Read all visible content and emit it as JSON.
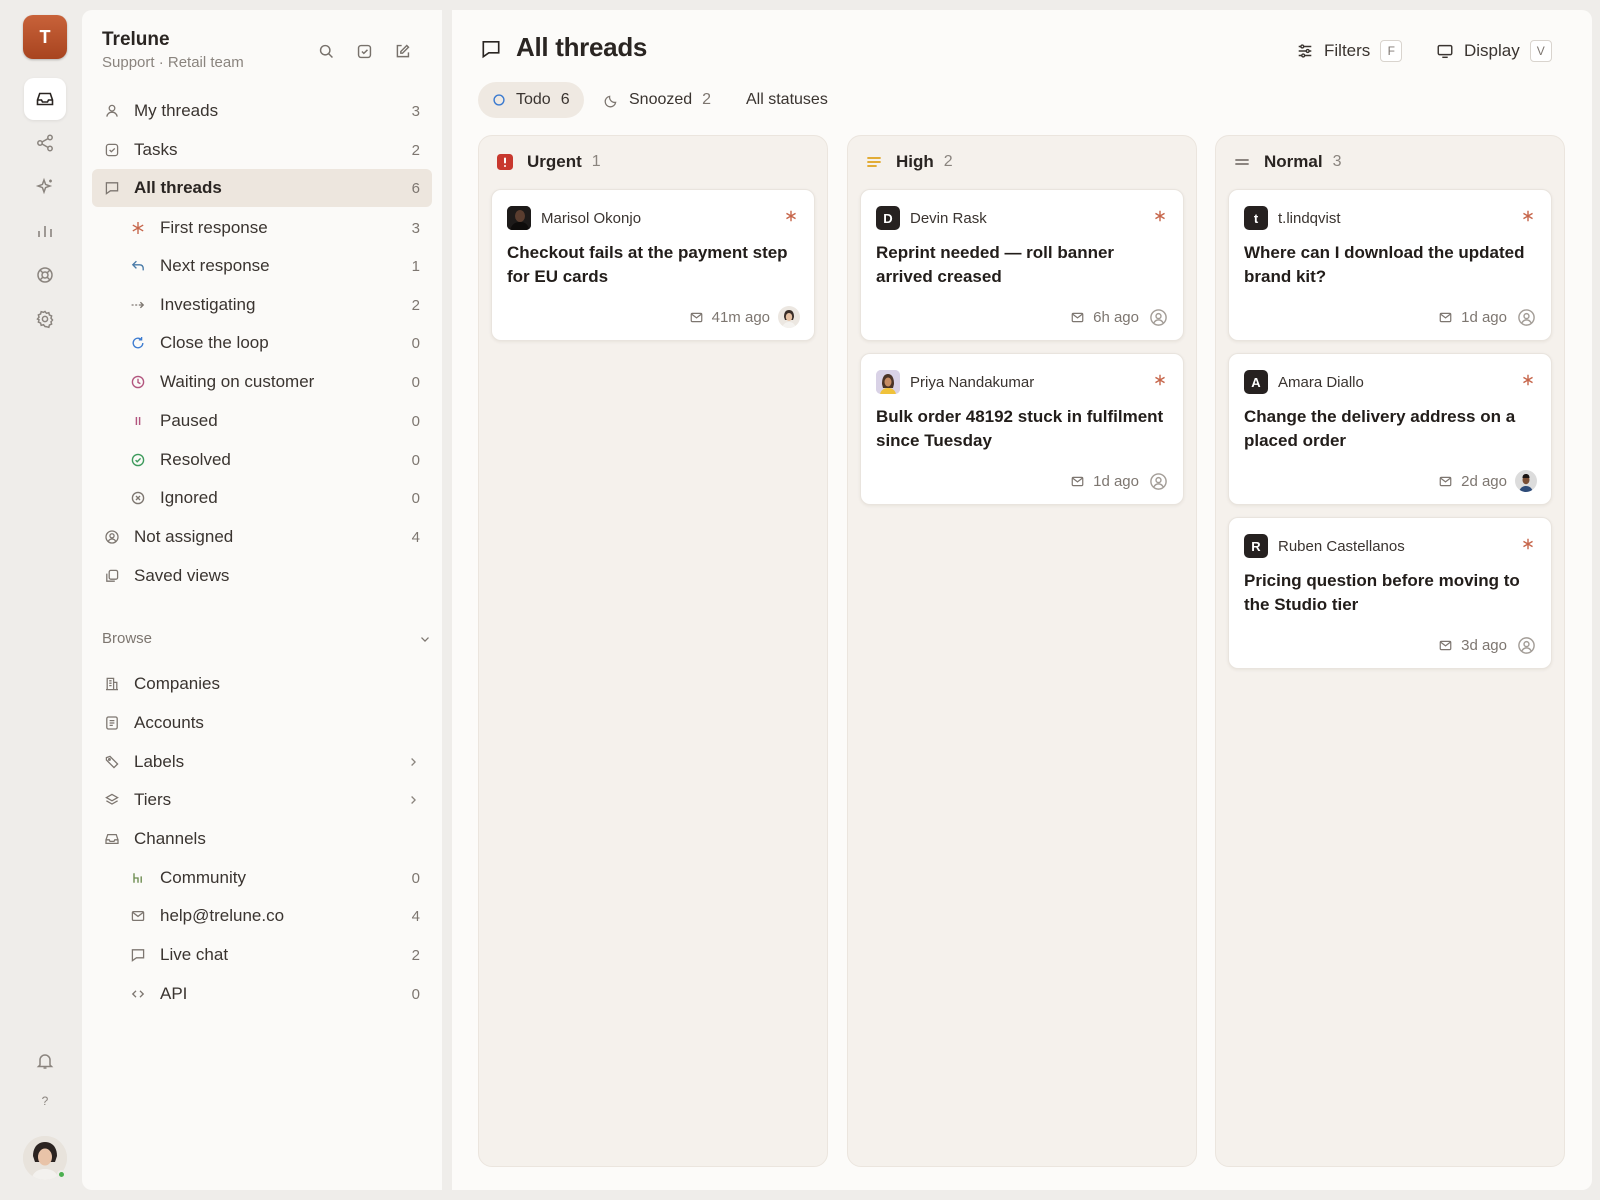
{
  "workspace": {
    "initial": "T",
    "name": "Trelune",
    "subtitle": "Support · Retail team"
  },
  "rail": {
    "items": [
      "inbox-icon",
      "share-icon",
      "sparkle-icon",
      "chart-icon",
      "lifebuoy-icon",
      "gear-icon"
    ],
    "help_label": "?"
  },
  "sidebar": {
    "nav": [
      {
        "label": "My threads",
        "count": "3",
        "icon": "user-icon"
      },
      {
        "label": "Tasks",
        "count": "2",
        "icon": "checkbox-icon"
      },
      {
        "label": "All threads",
        "count": "6",
        "icon": "chat-icon",
        "active": true
      }
    ],
    "subnav": [
      {
        "label": "First response",
        "count": "3",
        "icon": "asterisk-icon",
        "color": "#c6654a"
      },
      {
        "label": "Next response",
        "count": "1",
        "icon": "reply-icon",
        "color": "#4a7ba8"
      },
      {
        "label": "Investigating",
        "count": "2",
        "icon": "dashed-arrow-icon",
        "color": "#7d7670"
      },
      {
        "label": "Close the loop",
        "count": "0",
        "icon": "refresh-icon",
        "color": "#3c7bd0"
      },
      {
        "label": "Waiting on customer",
        "count": "0",
        "icon": "clock-icon",
        "color": "#b2557e"
      },
      {
        "label": "Paused",
        "count": "0",
        "icon": "pause-icon",
        "color": "#b2557e"
      },
      {
        "label": "Resolved",
        "count": "0",
        "icon": "check-circle-icon",
        "color": "#3d9a5c"
      },
      {
        "label": "Ignored",
        "count": "0",
        "icon": "x-circle-icon",
        "color": "#8a847e"
      }
    ],
    "nav2": [
      {
        "label": "Not assigned",
        "count": "4",
        "icon": "user-circle-icon"
      },
      {
        "label": "Saved views",
        "icon": "copy-icon"
      }
    ],
    "browse_label": "Browse",
    "browse": [
      {
        "label": "Companies",
        "icon": "building-icon"
      },
      {
        "label": "Accounts",
        "icon": "list-icon"
      },
      {
        "label": "Labels",
        "icon": "tag-icon",
        "chevron": true
      },
      {
        "label": "Tiers",
        "icon": "layers-icon",
        "chevron": true
      },
      {
        "label": "Channels",
        "icon": "inbox-icon"
      }
    ],
    "channels": [
      {
        "label": "Community",
        "count": "0",
        "icon": "community-icon"
      },
      {
        "label": "help@trelune.co",
        "count": "4",
        "icon": "mail-icon"
      },
      {
        "label": "Live chat",
        "count": "2",
        "icon": "chat-icon"
      },
      {
        "label": "API",
        "count": "0",
        "icon": "code-icon"
      }
    ]
  },
  "main": {
    "title": "All threads",
    "filters_label": "Filters",
    "filters_key": "F",
    "display_label": "Display",
    "display_key": "V",
    "tabs": [
      {
        "label": "Todo",
        "count": "6",
        "active": true
      },
      {
        "label": "Snoozed",
        "count": "2"
      },
      {
        "label": "All statuses"
      }
    ],
    "columns": [
      {
        "label": "Urgent",
        "count": "1",
        "color": "#c8382e",
        "cards": [
          {
            "author": "Marisol Okonjo",
            "avatar": "photo",
            "title": "Checkout fails at the payment step for EU cards",
            "time": "41m ago",
            "assignee": "photo"
          }
        ]
      },
      {
        "label": "High",
        "count": "2",
        "color": "#e0a21c",
        "cards": [
          {
            "author": "Devin Rask",
            "avatar": "D",
            "title": "Reprint needed — roll banner arrived creased",
            "time": "6h ago",
            "assignee": "none"
          },
          {
            "author": "Priya Nandakumar",
            "avatar": "photo",
            "title": "Bulk order 48192 stuck in fulfilment since Tuesday",
            "time": "1d ago",
            "assignee": "none"
          }
        ]
      },
      {
        "label": "Normal",
        "count": "3",
        "color": "#7d7670",
        "cards": [
          {
            "author": "t.lindqvist",
            "avatar": "t",
            "title": "Where can I download the updated brand kit?",
            "time": "1d ago",
            "assignee": "none"
          },
          {
            "author": "Amara Diallo",
            "avatar": "A",
            "title": "Change the delivery address on a placed order",
            "time": "2d ago",
            "assignee": "photo"
          },
          {
            "author": "Ruben Castellanos",
            "avatar": "R",
            "title": "Pricing question before moving to the Studio tier",
            "time": "3d ago",
            "assignee": "none"
          }
        ]
      }
    ]
  }
}
